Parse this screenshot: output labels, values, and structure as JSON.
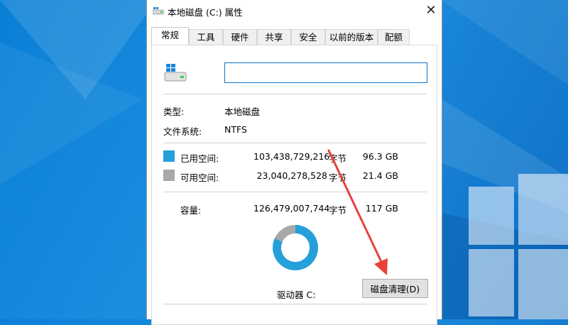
{
  "window": {
    "title": "本地磁盘 (C:) 属性",
    "close_glyph": "✕"
  },
  "tabs": [
    {
      "label": "常规",
      "active": true
    },
    {
      "label": "工具"
    },
    {
      "label": "硬件"
    },
    {
      "label": "共享"
    },
    {
      "label": "安全"
    },
    {
      "label": "以前的版本"
    },
    {
      "label": "配额"
    }
  ],
  "general": {
    "name_value": "",
    "type_label": "类型:",
    "type_value": "本地磁盘",
    "fs_label": "文件系统:",
    "fs_value": "NTFS",
    "used": {
      "label": "已用空间:",
      "bytes": "103,438,729,216",
      "unit": "字节",
      "size": "96.3 GB",
      "color": "#26a0da"
    },
    "free": {
      "label": "可用空间:",
      "bytes": "23,040,278,528",
      "unit": "字节",
      "size": "21.4 GB",
      "color": "#a8a8a8"
    },
    "capacity": {
      "label": "容量:",
      "bytes": "126,479,007,744",
      "unit": "字节",
      "size": "117 GB"
    },
    "used_fraction": 0.818,
    "drive_label": "驱动器 C:",
    "cleanup_label": "磁盘清理(D)"
  },
  "colors": {
    "accent": "#0a74c9",
    "arrow": "#e8423a"
  }
}
